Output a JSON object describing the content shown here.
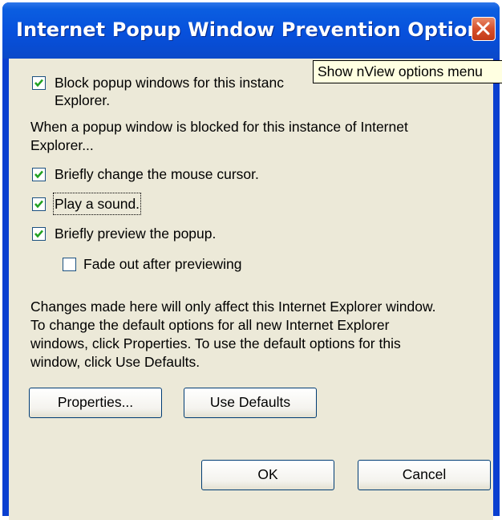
{
  "dialog": {
    "title": "Internet Popup Window Prevention Options",
    "block_label_line1": "Block popup windows for this instanc",
    "block_label_line2": "Explorer.",
    "block_checked": true,
    "intro_text": "When a popup window is blocked for this instance of Internet\nExplorer...",
    "options": [
      {
        "label": "Briefly change the mouse cursor.",
        "checked": true
      },
      {
        "label": "Play a sound.",
        "checked": true
      },
      {
        "label": "Briefly preview the popup.",
        "checked": true
      },
      {
        "label": "Fade out after previewing",
        "checked": false
      }
    ],
    "info_text": "Changes made here will only affect this Internet Explorer window.\nTo change the default options for all new Internet Explorer\nwindows, click Properties. To use the default options for this\nwindow, click Use Defaults.",
    "buttons": {
      "properties": "Properties...",
      "use_defaults": "Use Defaults",
      "ok": "OK",
      "cancel": "Cancel"
    }
  },
  "tooltip": {
    "text": "Show nView options menu"
  },
  "colors": {
    "titlebar": "#0750dc",
    "client": "#ece9d8",
    "close": "#d6502c",
    "tooltip_bg": "#ffffe1"
  },
  "icons": {
    "close": "close-x-icon",
    "check": "checkmark-icon"
  }
}
